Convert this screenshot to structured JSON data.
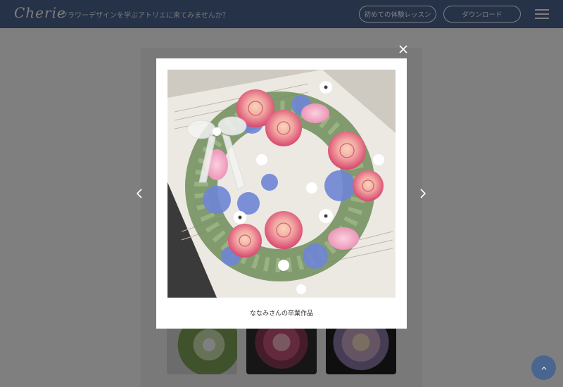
{
  "header": {
    "logo": "Cherie",
    "tagline": "フラワーデザインを学ぶアトリエに来てみませんか？",
    "trial_button": "初めての体験レッスン",
    "download_button": "ダウンロード"
  },
  "lightbox": {
    "caption": "ななみさんの卒業作品"
  },
  "colors": {
    "header_bg": "#4a6590",
    "overlay": "rgba(0,0,0,0.5)",
    "accent": "#4a6590"
  },
  "icons": {
    "close": "close-icon",
    "prev": "chevron-left-icon",
    "next": "chevron-right-icon",
    "menu": "hamburger-menu-icon",
    "scroll_top": "arrow-up-icon"
  }
}
